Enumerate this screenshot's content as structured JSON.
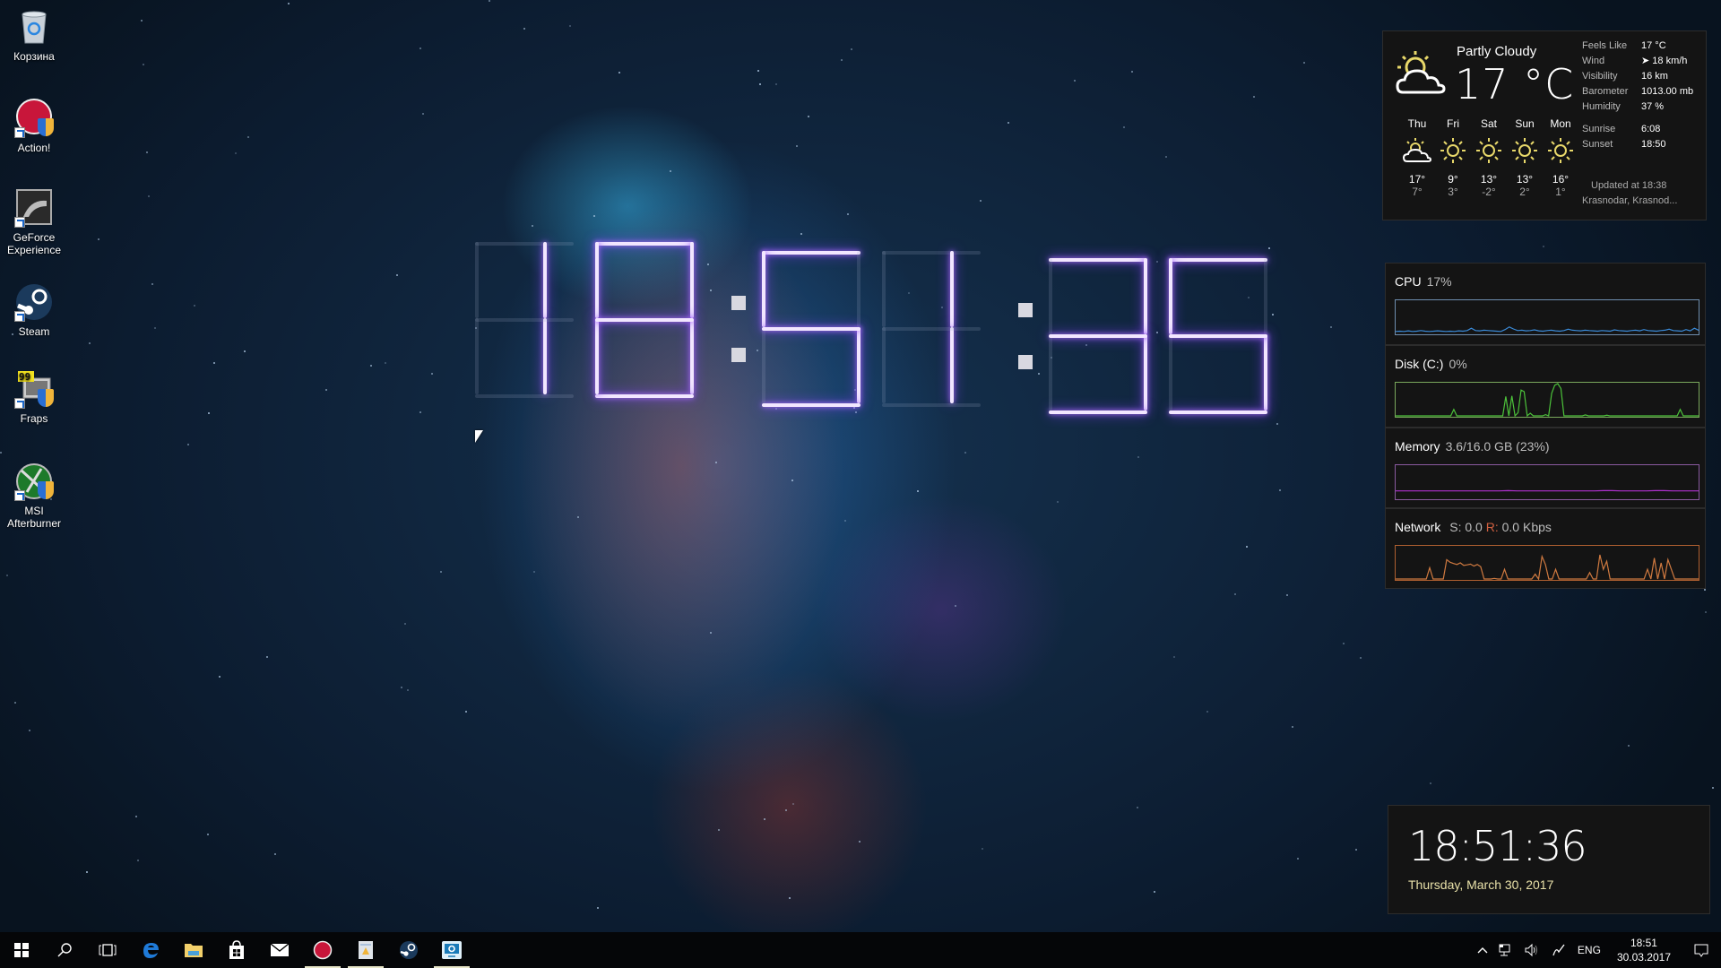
{
  "desktop": {
    "icons": [
      {
        "label": "Корзина",
        "icon": "recycle-bin-icon"
      },
      {
        "label": "Action!",
        "icon": "action-record-icon"
      },
      {
        "label": "GeForce Experience",
        "icon": "geforce-experience-icon"
      },
      {
        "label": "Steam",
        "icon": "steam-icon"
      },
      {
        "label": "Fraps",
        "icon": "fraps-icon"
      },
      {
        "label": "MSI Afterburner",
        "icon": "msi-afterburner-icon"
      }
    ]
  },
  "big_clock": {
    "time": "18:51:35",
    "segment_color": "#f2e6ff",
    "glow_color": "#9050ff"
  },
  "weather": {
    "condition": "Partly Cloudy",
    "temperature": "17 °C",
    "current_icon": "partly-cloudy-icon",
    "details": [
      {
        "key": "Feels Like",
        "value": "17 °C"
      },
      {
        "key": "Wind",
        "value": "➤ 18 km/h"
      },
      {
        "key": "Visibility",
        "value": "16 km"
      },
      {
        "key": "Barometer",
        "value": "1013.00 mb"
      },
      {
        "key": "Humidity",
        "value": "37 %"
      }
    ],
    "sun": [
      {
        "key": "Sunrise",
        "value": "6:08"
      },
      {
        "key": "Sunset",
        "value": "18:50"
      }
    ],
    "updated": "Updated at 18:38",
    "location": "Krasnodar, Krasnod...",
    "forecast": [
      {
        "day": "Thu",
        "icon": "partly-cloudy-icon",
        "high": "17°",
        "low": "7°"
      },
      {
        "day": "Fri",
        "icon": "sunny-icon",
        "high": "9°",
        "low": "3°"
      },
      {
        "day": "Sat",
        "icon": "sunny-icon",
        "high": "13°",
        "low": "-2°"
      },
      {
        "day": "Sun",
        "icon": "sunny-icon",
        "high": "13°",
        "low": "2°"
      },
      {
        "day": "Mon",
        "icon": "sunny-icon",
        "high": "16°",
        "low": "1°"
      }
    ]
  },
  "monitors": {
    "cpu": {
      "label": "CPU",
      "value": "17%",
      "color": "#3a8ad8",
      "border": "#6f8fb0",
      "history": [
        6,
        7,
        6,
        8,
        6,
        7,
        9,
        7,
        6,
        7,
        8,
        7,
        6,
        7,
        6,
        8,
        7,
        9,
        16,
        9,
        8,
        10,
        9,
        8,
        7,
        6,
        12,
        20,
        14,
        9,
        10,
        8,
        9,
        11,
        8,
        7,
        9,
        10,
        8,
        7,
        9,
        13,
        10,
        9,
        8,
        10,
        9,
        8,
        7,
        9,
        8,
        7,
        11,
        9,
        8,
        7,
        9,
        10,
        8,
        12,
        9,
        8,
        7,
        9,
        10,
        13,
        9,
        8,
        7,
        12,
        8,
        16,
        10
      ]
    },
    "disk": {
      "label": "Disk (C:)",
      "value": "0%",
      "color": "#4cc23a",
      "border": "#7aa85c",
      "history": [
        0,
        0,
        0,
        0,
        0,
        0,
        0,
        0,
        0,
        0,
        0,
        0,
        0,
        0,
        0,
        0,
        0,
        0,
        0,
        20,
        0,
        0,
        0,
        0,
        0,
        0,
        0,
        0,
        0,
        0,
        0,
        0,
        0,
        0,
        0,
        0,
        60,
        0,
        62,
        0,
        10,
        80,
        75,
        0,
        8,
        0,
        0,
        0,
        0,
        4,
        0,
        70,
        95,
        100,
        85,
        0,
        0,
        0,
        0,
        0,
        0,
        0,
        3,
        0,
        0,
        0,
        0,
        0,
        0,
        2,
        0,
        0,
        0,
        0,
        0,
        0,
        0,
        0,
        0,
        0,
        0,
        0,
        0,
        0,
        0,
        0,
        0,
        0,
        0,
        0,
        0,
        0,
        0,
        20,
        0,
        0,
        0,
        0,
        0,
        0
      ]
    },
    "memory": {
      "label": "Memory",
      "value": "3.6/16.0 GB (23%)",
      "color": "#b030d0",
      "border": "#8a5aa0",
      "history": [
        23,
        23,
        23,
        23,
        23,
        23,
        23,
        23,
        23,
        23,
        23,
        23,
        23,
        24,
        23,
        23,
        23,
        23,
        23,
        23,
        23,
        23,
        23,
        23,
        24,
        24,
        23,
        23,
        23,
        23,
        24,
        24,
        23,
        23,
        23,
        23
      ]
    },
    "network": {
      "label": "Network",
      "send_label": "S:",
      "send_value": "0.0",
      "recv_label": "R:",
      "recv_value": "0.0 Kbps",
      "recv_label_color": "#d06040",
      "color": "#d07a40",
      "border": "#b06030",
      "history": [
        0,
        0,
        0,
        0,
        0,
        0,
        0,
        0,
        0,
        0,
        35,
        0,
        0,
        0,
        0,
        60,
        52,
        48,
        45,
        50,
        42,
        44,
        46,
        40,
        45,
        38,
        0,
        0,
        0,
        2,
        0,
        0,
        30,
        0,
        0,
        0,
        0,
        0,
        0,
        0,
        0,
        15,
        0,
        70,
        45,
        0,
        0,
        30,
        0,
        0,
        0,
        0,
        0,
        0,
        0,
        0,
        0,
        20,
        0,
        0,
        75,
        30,
        55,
        0,
        0,
        0,
        0,
        0,
        0,
        0,
        0,
        0,
        0,
        0,
        30,
        0,
        65,
        0,
        50,
        0,
        60,
        30,
        0,
        0,
        0,
        0,
        0,
        0,
        0,
        0
      ]
    }
  },
  "clock_widget": {
    "time": "18:51:36",
    "date": "Thursday, March 30, 2017"
  },
  "taskbar": {
    "pinned": [
      {
        "name": "start-button",
        "icon": "windows-logo-icon",
        "active": false
      },
      {
        "name": "search-button",
        "icon": "search-icon",
        "active": false
      },
      {
        "name": "task-view-button",
        "icon": "task-view-icon",
        "active": false
      },
      {
        "name": "edge-button",
        "icon": "edge-icon",
        "active": false
      },
      {
        "name": "file-explorer-button",
        "icon": "folder-icon",
        "active": false
      },
      {
        "name": "store-button",
        "icon": "store-icon",
        "active": false
      },
      {
        "name": "mail-button",
        "icon": "mail-icon",
        "active": false
      },
      {
        "name": "action-app-button",
        "icon": "action-record-icon",
        "active": true
      },
      {
        "name": "notepad-app-button",
        "icon": "document-icon",
        "active": true
      },
      {
        "name": "steam-app-button",
        "icon": "steam-icon",
        "active": false
      },
      {
        "name": "settings-app-button",
        "icon": "settings-monitor-icon",
        "active": true
      }
    ],
    "tray": {
      "language": "ENG",
      "time": "18:51",
      "date": "30.03.2017"
    }
  }
}
